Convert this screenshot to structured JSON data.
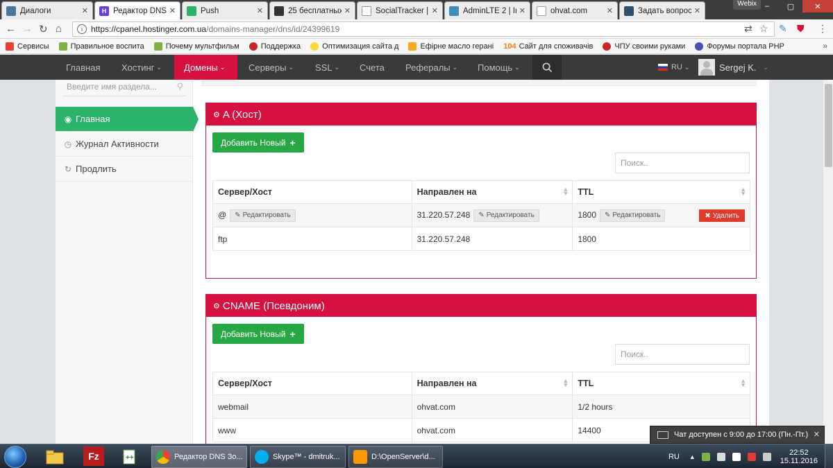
{
  "browser": {
    "tabs": [
      {
        "title": "Диалоги",
        "active": false,
        "favicon_color": "#4a76a8"
      },
      {
        "title": "Редактор DNS",
        "active": true,
        "favicon_color": "#673de6"
      },
      {
        "title": "Push",
        "active": false,
        "favicon_color": "#2bb36a"
      },
      {
        "title": "25 бесплатных",
        "active": false,
        "favicon_color": "#333333"
      },
      {
        "title": "SocialTracker |",
        "active": false,
        "favicon_color": "#ffffff"
      },
      {
        "title": "AdminLTE 2 | In",
        "active": false,
        "favicon_color": "#3c8dbc"
      },
      {
        "title": "ohvat.com",
        "active": false,
        "favicon_color": "#ffffff"
      },
      {
        "title": "Задать вопрос",
        "active": false,
        "favicon_color": "#2f4f6f"
      }
    ],
    "window_user": "Webix",
    "url_host": "https://cpanel.hostinger.com.ua",
    "url_path": "/domains-manager/dns/id/24399619",
    "bookmarks": [
      {
        "label": "Сервисы",
        "color": "#e94235"
      },
      {
        "label": "Правильное воспита",
        "color": "#7cb342"
      },
      {
        "label": "Почему мультфильм",
        "color": "#7cb342"
      },
      {
        "label": "Поддержка",
        "color": "#c62828"
      },
      {
        "label": "Оптимизация сайта д",
        "color": "#fdd835"
      },
      {
        "label": "Ефірне масло герані",
        "color": "#f9a825"
      },
      {
        "label": "Сайт для споживачів",
        "color": "#f57c00",
        "prefix": "104"
      },
      {
        "label": "ЧПУ своими руками",
        "color": "#c62828"
      },
      {
        "label": "Форумы портала PHP",
        "color": "#3f51b5"
      }
    ]
  },
  "nav": {
    "items": [
      "Главная",
      "Хостинг",
      "Домены",
      "Серверы",
      "SSL",
      "Счета",
      "Рефералы",
      "Помощь"
    ],
    "lang": "RU",
    "user": "Sergej K."
  },
  "sidebar": {
    "search_placeholder": "Введите имя раздела...",
    "items": [
      "Главная",
      "Журнал Активности",
      "Продлить"
    ]
  },
  "sections": [
    {
      "title": "A (Хост)",
      "add_label": "Добавить Новый",
      "search_placeholder": "Поиск..",
      "columns": [
        "Сервер/Хост",
        "Направлен на",
        "TTL"
      ],
      "rows": [
        {
          "host": "@",
          "target": "31.220.57.248",
          "ttl": "1800"
        },
        {
          "host": "ftp",
          "target": "31.220.57.248",
          "ttl": "1800"
        }
      ],
      "edit_label": "Редактировать",
      "delete_label": "Удалить"
    },
    {
      "title": "CNAME (Псевдоним)",
      "add_label": "Добавить Новый",
      "search_placeholder": "Поиск..",
      "columns": [
        "Сервер/Хост",
        "Направлен на",
        "TTL"
      ],
      "rows": [
        {
          "host": "webmail",
          "target": "ohvat.com",
          "ttl": "1/2 hours"
        },
        {
          "host": "www",
          "target": "ohvat.com",
          "ttl": "14400"
        }
      ]
    }
  ],
  "chat_notice": "Чат доступен с 9:00 до 17:00 (Пн.-Пт.)",
  "taskbar": {
    "tasks": [
      "Редактор DNS Зо...",
      "Skype™ - dmitruk...",
      "D:\\OpenServer\\d..."
    ],
    "lang": "RU",
    "time": "22:52",
    "date": "15.11.2016"
  },
  "colors": {
    "accent": "#d6113f",
    "success": "#28a745",
    "danger": "#e03a2c",
    "nav_bg": "#3a3a3a"
  }
}
